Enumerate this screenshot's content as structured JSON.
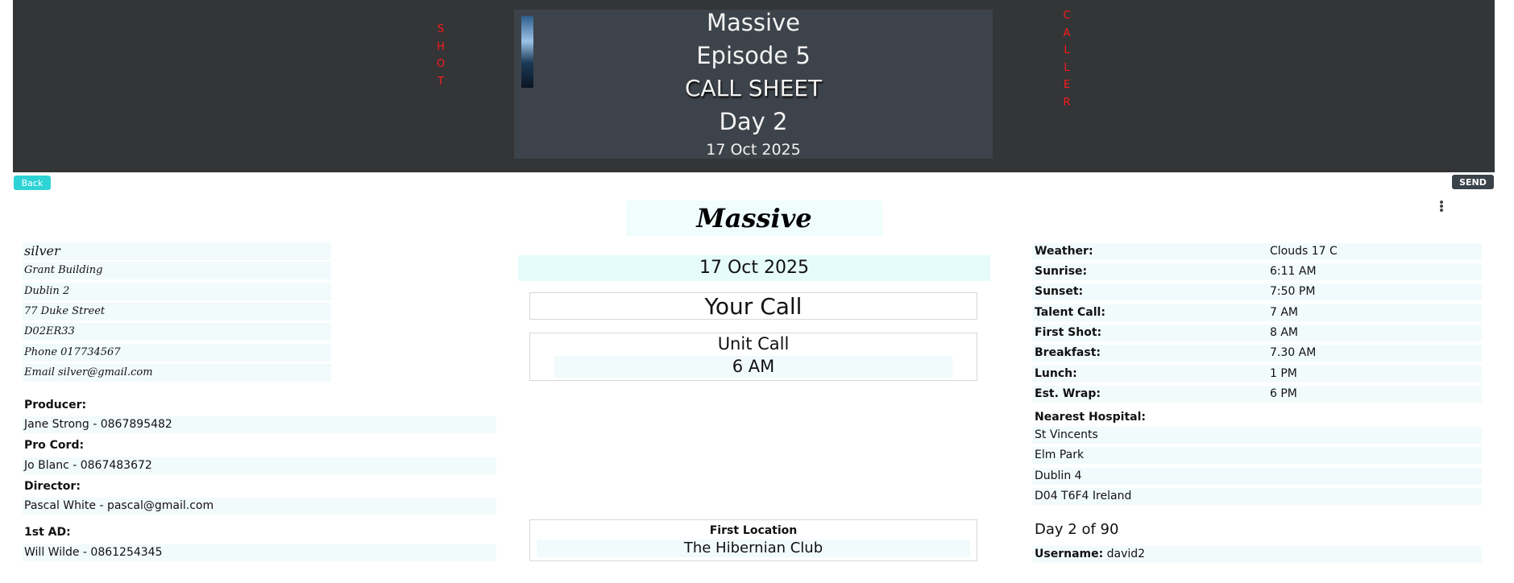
{
  "header": {
    "title": "Massive",
    "episode": "Episode 5",
    "sheet_label": "CALL SHEET",
    "day": "Day 2",
    "date": "17 Oct 2025",
    "shot_vertical": "SHOT",
    "caller_vertical": "CALLER"
  },
  "toolbar": {
    "back_label": "Back",
    "send_label": "SEND"
  },
  "production_title": "Massive",
  "address": {
    "name": "silver",
    "lines": [
      "Grant Building",
      "Dublin 2",
      "77 Duke Street",
      "D02ER33",
      "Phone 017734567",
      "Email silver@gmail.com"
    ]
  },
  "crew": [
    {
      "role": "Producer:",
      "value": "Jane Strong - 0867895482"
    },
    {
      "role": "Pro Cord:",
      "value": "Jo Blanc - 0867483672"
    },
    {
      "role": "Director:",
      "value": "Pascal White - pascal@gmail.com"
    },
    {
      "role": "1st AD:",
      "value": "Will Wilde - 0861254345"
    }
  ],
  "center": {
    "date": "17 Oct 2025",
    "your_call": "Your Call",
    "unit_call_label": "Unit Call",
    "unit_call_time": "6 AM",
    "first_location_label": "First Location",
    "first_location": "The Hibernian Club"
  },
  "info": [
    {
      "label": "Weather:",
      "value": "Clouds 17 C"
    },
    {
      "label": "Sunrise:",
      "value": "6:11 AM"
    },
    {
      "label": "Sunset:",
      "value": "7:50 PM"
    },
    {
      "label": "Talent Call:",
      "value": "7 AM"
    },
    {
      "label": "First Shot:",
      "value": "8 AM"
    },
    {
      "label": "Breakfast:",
      "value": "7.30 AM"
    },
    {
      "label": "Lunch:",
      "value": "1 PM"
    },
    {
      "label": "Est. Wrap:",
      "value": "6 PM"
    }
  ],
  "hospital": {
    "label": "Nearest Hospital:",
    "lines": [
      "St Vincents",
      "Elm Park",
      "Dublin 4",
      "D04 T6F4 Ireland"
    ]
  },
  "day_of": "Day 2 of 90",
  "username": {
    "label": "Username:",
    "value": "david2"
  },
  "colors": {
    "header_bg": "#333537",
    "header_box": "#3d434a",
    "back_button": "#2ed3d6",
    "send_button": "#3a424a",
    "vertical_text": "#ff1a1a",
    "row_bg": "#f2fbfc"
  },
  "icons": {
    "menu": "kebab-menu-icon",
    "poster": "poster-thumbnail"
  }
}
